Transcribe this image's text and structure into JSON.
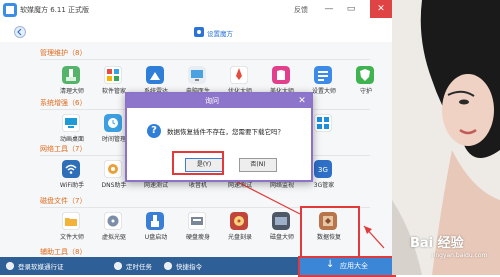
{
  "window": {
    "title": "软媒魔方 6.11 正式版",
    "feedback": "反馈",
    "minimize": "—",
    "restore": "▭",
    "close": "✕",
    "settings_label": "设置魔方"
  },
  "sections": [
    {
      "label": "管理维护（8）",
      "tools": [
        "清理大师",
        "软件管家",
        "系统雷达",
        "电脑医生",
        "优化大师",
        "美化大师",
        "设置大师",
        "守护"
      ]
    },
    {
      "label": "系统增强（6）",
      "tools": [
        "动画桌面",
        "时间管理"
      ]
    },
    {
      "label": "网络工具（7）",
      "tools": [
        "WiFi助手",
        "DNS助手",
        "网速测试",
        "收音机",
        "网速测试",
        "网络监视",
        "3G管家"
      ]
    },
    {
      "label": "磁盘文件（7）",
      "tools": [
        "文件大师",
        "虚拟光驱",
        "U盘启动",
        "硬盘瘦身",
        "光盘刻录",
        "磁盘大师",
        "数据恢复"
      ]
    },
    {
      "label": "辅助工具（8）",
      "tools": []
    }
  ],
  "dialog": {
    "title": "询问",
    "message": "数据恢复插件不存在，您需要下载它吗？",
    "yes": "是(Y)",
    "no": "否(N)",
    "close": "✕",
    "icon": "?"
  },
  "bottombar": {
    "login": "登录软媒通行证",
    "tasks": "定时任务",
    "shortcut": "快捷指令",
    "apps_all": "应用大全",
    "arrow": "↓"
  },
  "watermark": {
    "main": "Bai 经验",
    "sub": "jingyan.baidu.com"
  },
  "colors": {
    "accent": "#2f5f97",
    "dialog": "#8e75cc",
    "section": "#e06a1a",
    "annotation": "#e23a3a"
  }
}
